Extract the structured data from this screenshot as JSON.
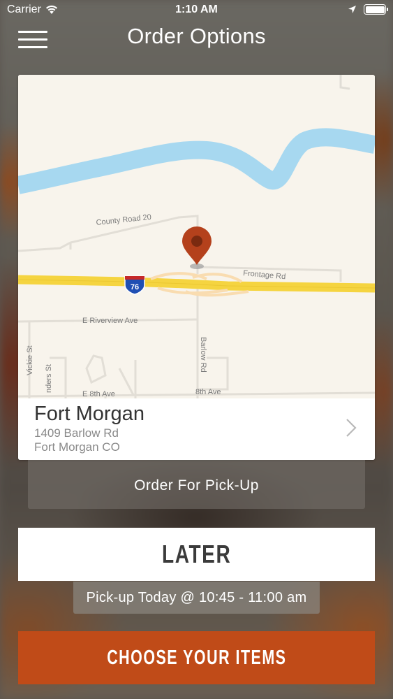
{
  "status_bar": {
    "carrier": "Carrier",
    "time": "1:10 AM"
  },
  "nav": {
    "title": "Order Options",
    "menu_icon": "hamburger-menu-icon"
  },
  "map": {
    "roads": {
      "county_road": "County Road 20",
      "frontage": "Frontage Rd",
      "riverview": "E Riverview Ave",
      "barlow": "Barlow Rd",
      "vickie": "Vickie St",
      "saunders": "nders St",
      "eighth_west": "E 8th Ave",
      "eighth_east": "8th Ave"
    },
    "interstate_shield": "76",
    "colors": {
      "land": "#f8f4ec",
      "water": "#a7d8f0",
      "highway": "#f5d440",
      "pin": "#b4411c"
    }
  },
  "location": {
    "name": "Fort Morgan",
    "address_line1": "1409 Barlow Rd",
    "address_line2": "Fort Morgan CO"
  },
  "order_type": {
    "label": "Order For Pick-Up"
  },
  "timing": {
    "label": "LATER",
    "pickup_time": "Pick-up Today @ 10:45 - 11:00 am"
  },
  "cta": {
    "label": "CHOOSE YOUR ITEMS",
    "color": "#c04b18"
  }
}
